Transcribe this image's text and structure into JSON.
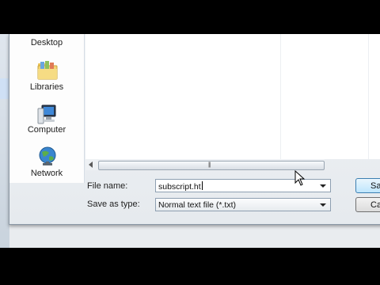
{
  "nav": {
    "items": [
      {
        "label": "Desktop"
      },
      {
        "label": "Libraries"
      },
      {
        "label": "Computer"
      },
      {
        "label": "Network"
      }
    ]
  },
  "form": {
    "file_name_label": "File name:",
    "file_name_value": "subscript.ht",
    "save_type_label": "Save as type:",
    "save_type_value": "Normal text file (*.txt)"
  },
  "buttons": {
    "save": "Sa",
    "cancel": "Ca"
  },
  "icons": {
    "libraries": "libraries-folder-icon",
    "computer": "computer-icon",
    "network": "network-globe-icon"
  }
}
